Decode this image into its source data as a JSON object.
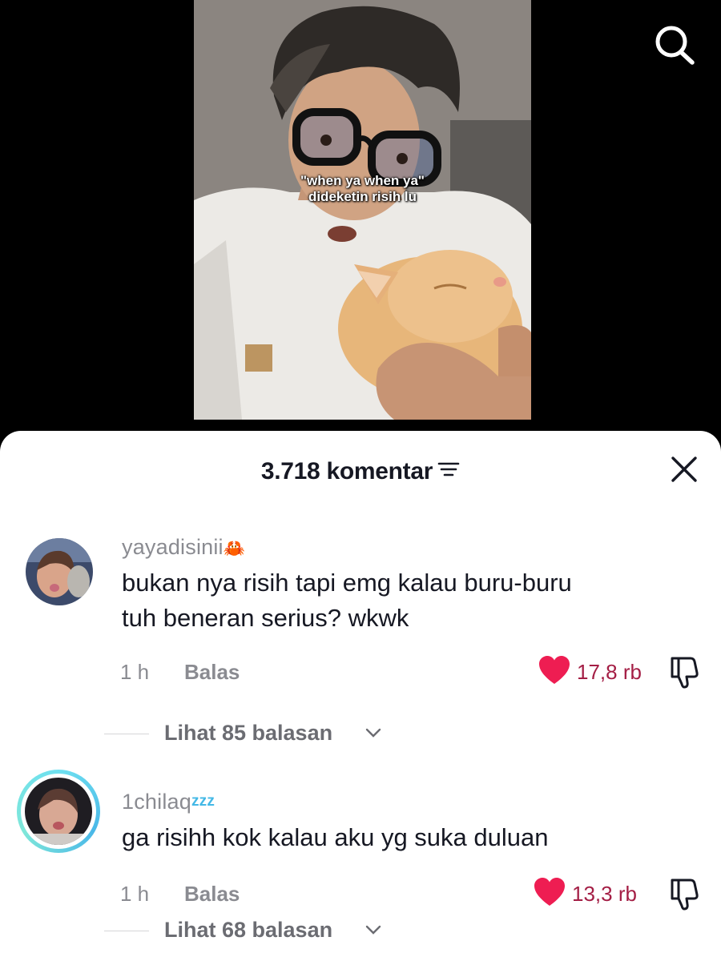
{
  "video": {
    "caption_line1": "\"when ya when ya\"",
    "caption_line2": "dideketin risih lu",
    "search_icon": "search-icon"
  },
  "comments_panel": {
    "count_label": "3.718 komentar",
    "filter_icon": "filter-icon",
    "close_icon": "close-icon"
  },
  "comments": [
    {
      "username": "yayadisinii",
      "username_emoji": "🦀",
      "text_line1": "bukan nya risih tapi emg kalau buru-buru",
      "text_line2": "tuh beneran serius? wkwk",
      "time": "1 h",
      "reply_label": "Balas",
      "likes": "17,8 rb",
      "replies_label": "Lihat 85 balasan"
    },
    {
      "username": "1chilaq",
      "username_suffix": "zzz",
      "text_line1": "ga risihh kok kalau aku yg suka duluan",
      "time": "1 h",
      "reply_label": "Balas",
      "likes": "13,3 rb",
      "replies_label": "Lihat 68 balasan"
    }
  ],
  "colors": {
    "like_heart": "#ee1d52",
    "like_count": "#a41e45",
    "muted_text": "#8a8b91",
    "story_ring": "#4ab8e8"
  }
}
